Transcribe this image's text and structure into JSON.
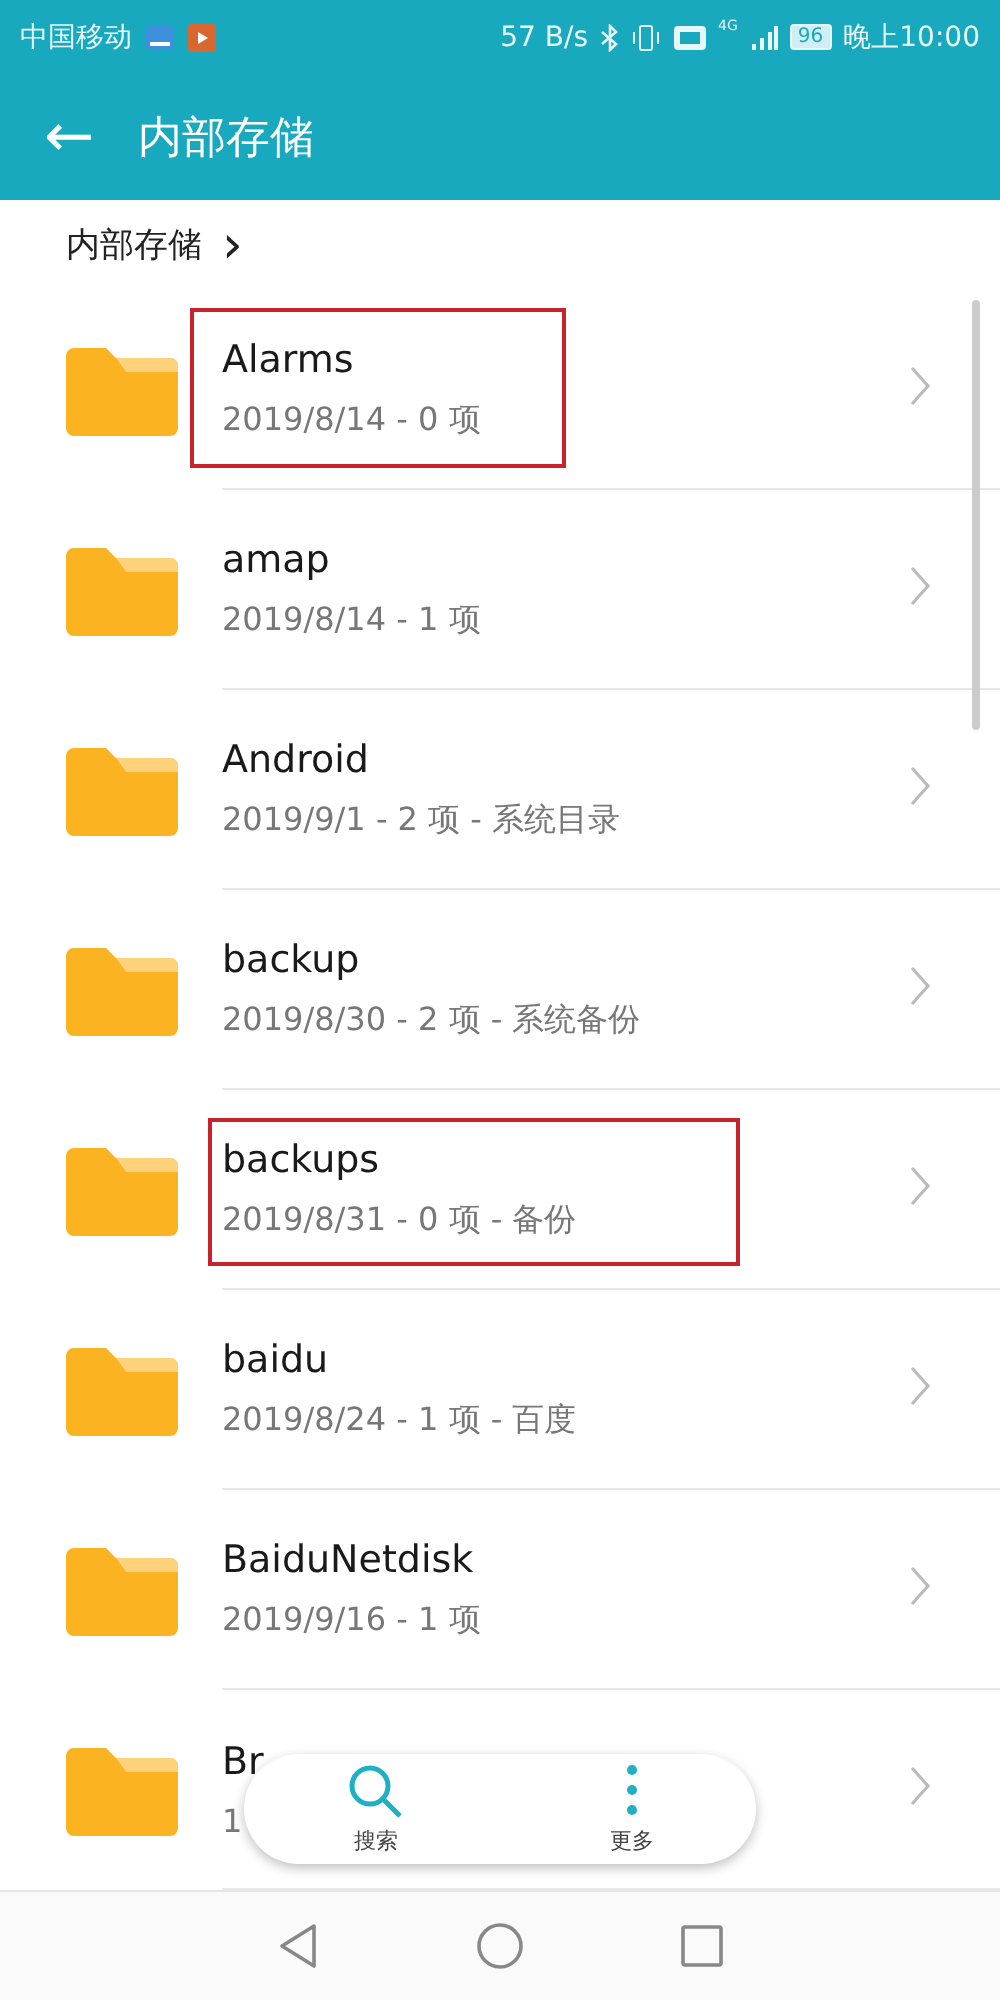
{
  "status_bar": {
    "carrier": "中国移动",
    "speed": "57 B/s",
    "network": "4G",
    "battery": "96",
    "time": "晚上10:00"
  },
  "header": {
    "back": "←",
    "title": "内部存储"
  },
  "breadcrumb": {
    "label": "内部存储",
    "chevron": "›"
  },
  "folders": [
    {
      "name": "Alarms",
      "meta": "2019/8/14 - 0 项",
      "highlighted": true
    },
    {
      "name": "amap",
      "meta": "2019/8/14 - 1 项",
      "highlighted": false
    },
    {
      "name": "Android",
      "meta": "2019/9/1 - 2 项 - 系统目录",
      "highlighted": false
    },
    {
      "name": "backup",
      "meta": "2019/8/30 - 2 项 - 系统备份",
      "highlighted": false
    },
    {
      "name": "backups",
      "meta": "2019/8/31 - 0 项 - 备份",
      "highlighted": true
    },
    {
      "name": "baidu",
      "meta": "2019/8/24 - 1 项 - 百度",
      "highlighted": false
    },
    {
      "name": "BaiduNetdisk",
      "meta": "2019/9/16 - 1 项",
      "highlighted": false
    },
    {
      "name": "Br",
      "meta": "1",
      "highlighted": false
    }
  ],
  "floating_bar": {
    "actions": [
      {
        "kind": "search",
        "label": "搜索"
      },
      {
        "kind": "more",
        "label": "更多"
      }
    ]
  }
}
